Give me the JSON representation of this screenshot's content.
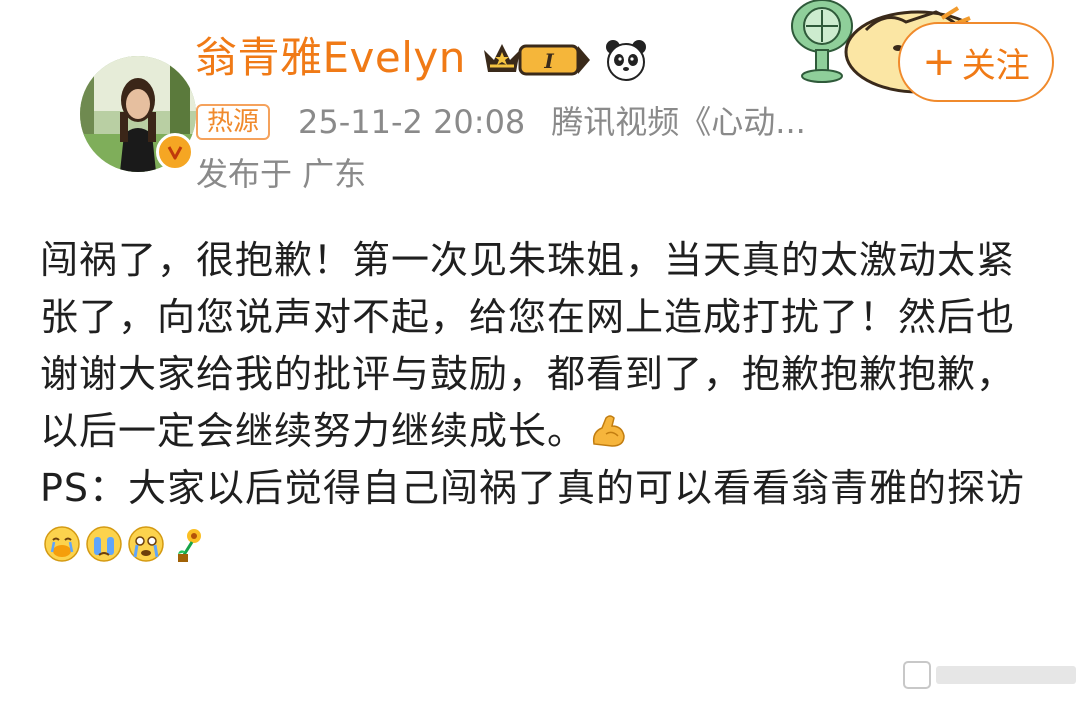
{
  "author": {
    "name": "翁青雅Evelyn",
    "verified_mark": "V",
    "membership_level": "I",
    "badges": [
      "crown-member-badge",
      "panda-icon"
    ]
  },
  "meta": {
    "hot_tag": "热源",
    "time": "25-11-2 20:08",
    "source": "腾讯视频《心动...",
    "location": "发布于 广东"
  },
  "follow_button": {
    "label": "关注",
    "plus": "+"
  },
  "content": {
    "paragraph1": "闯祸了，很抱歉！第一次见朱珠姐，当天真的太激动太紧张了，向您说声对不起，给您在网上造成打扰了！然后也谢谢大家给我的批评与鼓励，都看到了，抱歉抱歉抱歉，以后一定会继续努力继续成长。",
    "paragraph2": "PS：大家以后觉得自己闯祸了真的可以看看翁青雅的探访",
    "emojis": [
      "muscle-emoji",
      "cover-mouth-cry-emoji",
      "crying-emoji",
      "tearful-emoji",
      "flower-emoji"
    ]
  },
  "colors": {
    "accent": "#f07a16",
    "meta_gray": "#8a8a8a",
    "text": "#1f1f1f",
    "badge_gold": "#f5a623"
  }
}
